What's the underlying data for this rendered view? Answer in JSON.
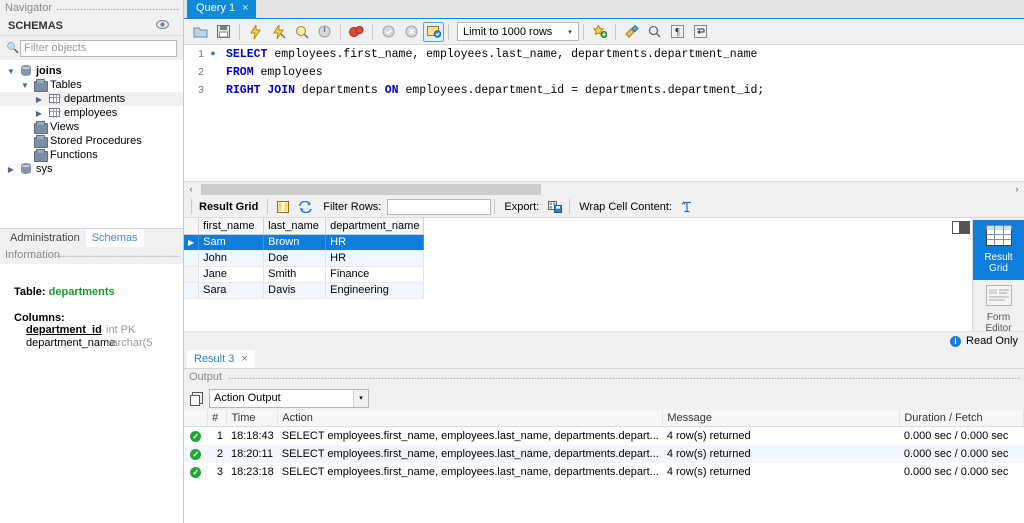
{
  "sidebar": {
    "navigator_caption": "Navigator",
    "schemas_header": "SCHEMAS",
    "refresh_icon": "eye-refresh-icon",
    "filter_placeholder": "Filter objects",
    "tree": [
      {
        "label": "joins",
        "icon": "database-icon",
        "depth": 0,
        "twisty": "down",
        "bold": true,
        "selected": false
      },
      {
        "label": "Tables",
        "icon": "folder-icon",
        "depth": 1,
        "twisty": "down",
        "bold": false,
        "selected": false
      },
      {
        "label": "departments",
        "icon": "table-icon",
        "depth": 2,
        "twisty": "right",
        "bold": false,
        "selected": true
      },
      {
        "label": "employees",
        "icon": "table-icon",
        "depth": 2,
        "twisty": "right",
        "bold": false,
        "selected": false
      },
      {
        "label": "Views",
        "icon": "folder-icon",
        "depth": 1,
        "twisty": "none",
        "bold": false,
        "selected": false
      },
      {
        "label": "Stored Procedures",
        "icon": "folder-icon",
        "depth": 1,
        "twisty": "none",
        "bold": false,
        "selected": false
      },
      {
        "label": "Functions",
        "icon": "folder-icon",
        "depth": 1,
        "twisty": "none",
        "bold": false,
        "selected": false
      },
      {
        "label": "sys",
        "icon": "database-icon",
        "depth": 0,
        "twisty": "right",
        "bold": false,
        "selected": false
      }
    ],
    "tabs": [
      {
        "label": "Administration",
        "active": false
      },
      {
        "label": "Schemas",
        "active": true
      }
    ],
    "information_caption": "Information",
    "info": {
      "table_key": "Table:",
      "table_name": "departments",
      "columns_key": "Columns:",
      "columns": [
        {
          "name": "department_id",
          "type": "int PK",
          "pk": true
        },
        {
          "name": "department_name",
          "type": "varchar(5",
          "pk": false
        }
      ]
    }
  },
  "query_tabs": [
    {
      "label": "Query 1",
      "close": "×",
      "active": true
    }
  ],
  "toolbar": {
    "buttons": [
      {
        "name": "open-sql-script-icon",
        "glyph": "📁"
      },
      {
        "name": "save-sql-script-icon",
        "glyph": "💾"
      },
      {
        "name": "execute-statement-icon",
        "glyph": "⚡"
      },
      {
        "name": "execute-current-statement-icon",
        "glyph": "⚡"
      },
      {
        "name": "explain-query-icon",
        "glyph": "🔍"
      },
      {
        "name": "stop-execution-icon",
        "glyph": "◕"
      },
      {
        "name": "toggle-stop-on-error-icon",
        "glyph": "🔴"
      },
      {
        "name": "commit-transaction-icon",
        "glyph": "✔"
      },
      {
        "name": "rollback-transaction-icon",
        "glyph": "✖"
      },
      {
        "name": "toggle-autocommit-icon",
        "glyph": "🗒"
      }
    ],
    "limit_label": "Limit to 1000 rows",
    "limit_arrow": "▾",
    "right_buttons": [
      {
        "name": "add-snippet-icon",
        "glyph": "★"
      },
      {
        "name": "beautify-sql-icon",
        "glyph": "🧹"
      },
      {
        "name": "find-icon",
        "glyph": "🔍"
      },
      {
        "name": "toggle-invisible-characters-icon",
        "glyph": "¶"
      },
      {
        "name": "toggle-word-wrap-icon",
        "glyph": "↵"
      }
    ]
  },
  "editor": {
    "lines": [
      {
        "number": "1",
        "has_bullet": true,
        "tokens": [
          {
            "t": "SELECT",
            "kw": true
          },
          {
            "t": " employees.first_name, employees.last_name, departments.department_name",
            "kw": false
          }
        ]
      },
      {
        "number": "2",
        "has_bullet": false,
        "tokens": [
          {
            "t": "FROM",
            "kw": true
          },
          {
            "t": " employees",
            "kw": false
          }
        ]
      },
      {
        "number": "3",
        "has_bullet": false,
        "tokens": [
          {
            "t": "RIGHT JOIN",
            "kw": true
          },
          {
            "t": " departments ",
            "kw": false
          },
          {
            "t": "ON",
            "kw": true
          },
          {
            "t": " employees.department_id = departments.department_id;",
            "kw": false
          }
        ]
      }
    ],
    "scroll_left_arrow": "‹",
    "scroll_right_arrow": "›"
  },
  "result_toolbar": {
    "result_grid_label": "Result Grid",
    "grid_view_icon": "grid-columns-icon",
    "refresh_icon": "refresh-icon",
    "filter_rows_label": "Filter Rows:",
    "filter_rows_value": "",
    "export_label": "Export:",
    "export_icon": "export-icon",
    "wrap_label": "Wrap Cell Content:",
    "wrap_icon": "wrap-text-icon"
  },
  "result_grid": {
    "columns": [
      "first_name",
      "last_name",
      "department_name"
    ],
    "rows": [
      {
        "cells": [
          "Sam",
          "Brown",
          "HR"
        ],
        "selected": true
      },
      {
        "cells": [
          "John",
          "Doe",
          "HR"
        ],
        "selected": false
      },
      {
        "cells": [
          "Jane",
          "Smith",
          "Finance"
        ],
        "selected": false
      },
      {
        "cells": [
          "Sara",
          "Davis",
          "Engineering"
        ],
        "selected": false
      }
    ],
    "row_marker": "▶"
  },
  "right_panel": {
    "items": [
      {
        "label_1": "Result",
        "label_2": "Grid",
        "icon": "result-grid-icon",
        "active": true
      },
      {
        "label_1": "Form",
        "label_2": "Editor",
        "icon": "form-editor-icon",
        "active": false
      }
    ],
    "chevron_up": "⌃",
    "chevron_down": "⌄",
    "panel_toggle_icon": "sidebar-toggle-icon"
  },
  "read_only": {
    "icon": "info-icon",
    "icon_char": "i",
    "label": "Read Only"
  },
  "result_tabs": [
    {
      "label": "Result 3",
      "close": "×",
      "active": true
    }
  ],
  "output": {
    "caption": "Output",
    "copy_icon": "copy-icon",
    "selected_view": "Action Output",
    "dropdown_arrow": "▾",
    "columns": [
      "#",
      "Time",
      "Action",
      "Message",
      "Duration / Fetch"
    ],
    "rows": [
      {
        "status": "success",
        "status_char": "✓",
        "num": "1",
        "time": "18:18:43",
        "action": "SELECT employees.first_name, employees.last_name, departments.depart...",
        "message": "4 row(s) returned",
        "duration": "0.000 sec / 0.000 sec"
      },
      {
        "status": "success",
        "status_char": "✓",
        "num": "2",
        "time": "18:20:11",
        "action": "SELECT employees.first_name, employees.last_name, departments.depart...",
        "message": "4 row(s) returned",
        "duration": "0.000 sec / 0.000 sec"
      },
      {
        "status": "success",
        "status_char": "✓",
        "num": "3",
        "time": "18:23:18",
        "action": "SELECT employees.first_name, employees.last_name, departments.depart...",
        "message": "4 row(s) returned",
        "duration": "0.000 sec / 0.000 sec"
      }
    ]
  },
  "colors": {
    "accent": "#0f7ddb",
    "tab_active": "#0f8ad8",
    "keyword": "#0000c8",
    "success": "#22a534",
    "schema_green": "#1a9a2e"
  }
}
